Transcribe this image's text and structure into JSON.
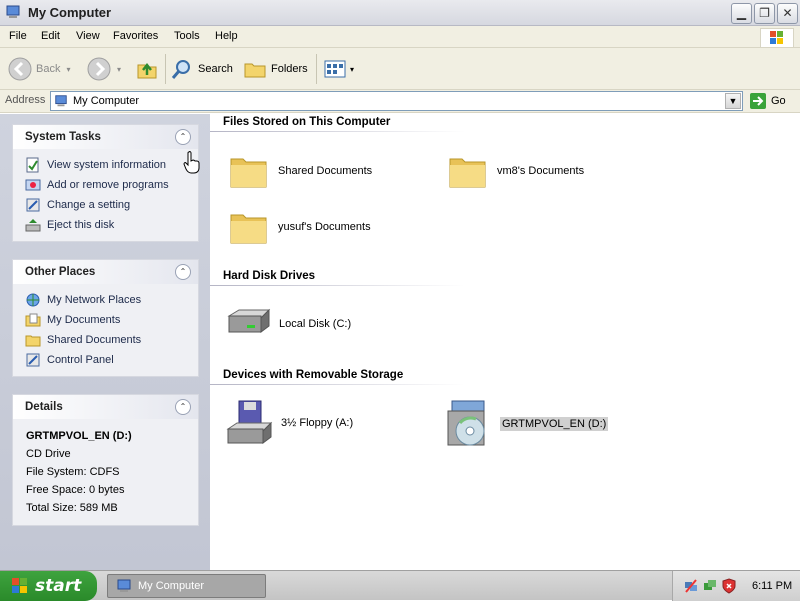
{
  "window": {
    "title": "My Computer",
    "controls": [
      "minimize",
      "restore",
      "close"
    ]
  },
  "menu": [
    "File",
    "Edit",
    "View",
    "Favorites",
    "Tools",
    "Help"
  ],
  "toolbar": {
    "back_label": "Back",
    "search_label": "Search",
    "folders_label": "Folders"
  },
  "address": {
    "label": "Address",
    "value": "My Computer",
    "go_label": "Go"
  },
  "system_tasks": {
    "title": "System Tasks",
    "items": [
      "View system information",
      "Add or remove programs",
      "Change a setting",
      "Eject this disk"
    ]
  },
  "other_places": {
    "title": "Other Places",
    "items": [
      "My Network Places",
      "My Documents",
      "Shared Documents",
      "Control Panel"
    ]
  },
  "details": {
    "title": "Details",
    "name": "GRTMPVOL_EN (D:)",
    "type": "CD Drive",
    "file_system": "File System: CDFS",
    "free_space": "Free Space: 0 bytes",
    "total_size": "Total Size: 589 MB"
  },
  "groups": {
    "files_stored": {
      "title": "Files Stored on This Computer",
      "items": [
        "Shared Documents",
        "vm8's Documents",
        "yusuf's Documents"
      ]
    },
    "hard_disks": {
      "title": "Hard Disk Drives",
      "items": [
        "Local Disk (C:)"
      ]
    },
    "removable": {
      "title": "Devices with Removable Storage",
      "items": [
        "3½ Floppy (A:)",
        "GRTMPVOL_EN (D:)"
      ]
    }
  },
  "taskbar": {
    "start_label": "start",
    "task_label": "My Computer",
    "clock": "6:11 PM"
  },
  "colors": {
    "left_pane_top": "#7aa1e6",
    "left_pane_bottom": "#6375d6",
    "start_green": "#3ea33e",
    "folder_yellow": "#f3d46b"
  }
}
